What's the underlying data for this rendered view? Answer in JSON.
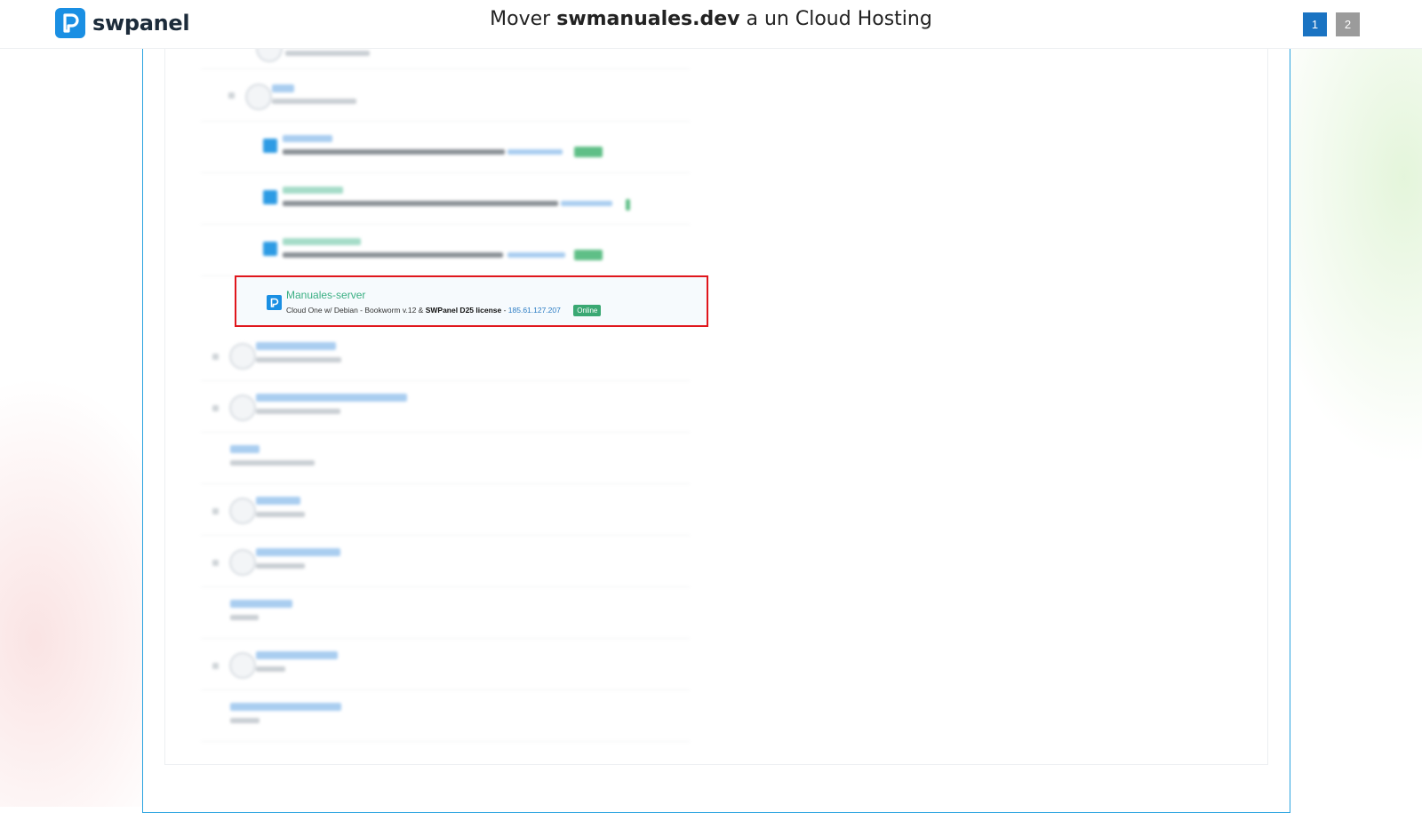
{
  "header": {
    "logo_text": "swpanel",
    "title_prefix": "Mover ",
    "title_bold": "swmanuales.dev",
    "title_suffix": " a un Cloud Hosting",
    "pages": [
      "1",
      "2"
    ],
    "active_page": "1"
  },
  "selected_server": {
    "name": "Manuales-server",
    "desc_prefix": "Cloud One w/ Debian - Bookworm v.12 & ",
    "desc_bold": "SWPanel D25 license",
    "desc_sep": " - ",
    "ip": "185.61.127.207",
    "status": "Online"
  },
  "colors": {
    "brand": "#1a8fe3",
    "highlight_border": "#e0161c",
    "online": "#3aa873"
  }
}
